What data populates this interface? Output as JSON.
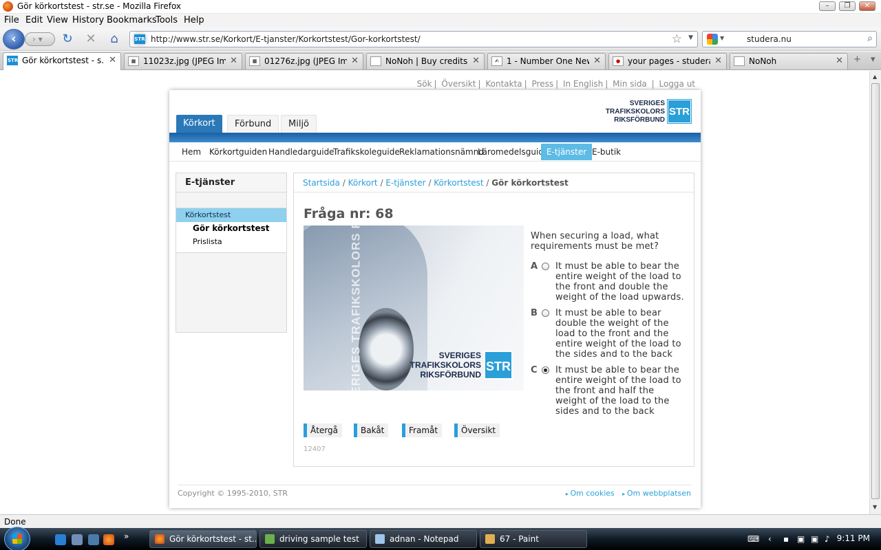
{
  "window": {
    "title": "Gör körkortstest - str.se - Mozilla Firefox"
  },
  "menu": [
    "File",
    "Edit",
    "View",
    "History",
    "Bookmarks",
    "Tools",
    "Help"
  ],
  "nav": {
    "url": "http://www.str.se/Korkort/E-tjanster/Korkortstest/Gor-korkortstest/",
    "search_value": "studera.nu"
  },
  "tabs": [
    {
      "label": "Gör körkortstest - s...",
      "active": true
    },
    {
      "label": "11023z.jpg (JPEG Ima..."
    },
    {
      "label": "01276z.jpg (JPEG Ima..."
    },
    {
      "label": "NoNoh | Buy credits ..."
    },
    {
      "label": "1 - Number One New..."
    },
    {
      "label": "your pages - studera...."
    },
    {
      "label": "NoNoh"
    }
  ],
  "site": {
    "top_links": [
      "Sök",
      "Översikt",
      "Kontakta",
      "Press",
      "In English",
      "Min sida",
      "Logga ut"
    ],
    "logo": {
      "line1": "SVERIGES",
      "line2": "TRAFIKSKOLORS",
      "line3": "RIKSFÖRBUND",
      "mark": "STR"
    },
    "main_tabs": [
      "Körkort",
      "Förbund",
      "Miljö"
    ],
    "sub_nav": [
      "Hem",
      "Körkortguiden",
      "Handledarguide",
      "Trafikskoleguide",
      "Reklamationsnämnd",
      "Läromedelsguide",
      "E-tjänster",
      "E-butik"
    ],
    "sidebar": {
      "heading": "E-tjänster",
      "selected": "Körkortstest",
      "items": [
        "Gör körkortstest",
        "Prislista"
      ]
    },
    "breadcrumb": {
      "links": [
        "Startsida",
        "Körkort",
        "E-tjänster",
        "Körkortstest"
      ],
      "current": "Gör körkortstest"
    },
    "quiz": {
      "title": "Fråga nr: 68",
      "photo_watermark": "SVERIGES TRAFIKSKOLORS RI",
      "question": "When securing a load, what requirements must be met?",
      "options": [
        {
          "letter": "A",
          "text": "It must be able to bear the entire weight of the load to the front and double the weight of the load upwards.",
          "selected": false
        },
        {
          "letter": "B",
          "text": "It must be able to bear double the weight of the load to the front and the entire weight of the load to the sides and to the back",
          "selected": false
        },
        {
          "letter": "C",
          "text": "It must be able to bear the entire weight of the load to the front and half the weight of the load to the sides and to the back",
          "selected": true
        }
      ],
      "buttons": [
        "Återgå",
        "Bakåt",
        "Framåt",
        "Översikt"
      ],
      "code": "12407"
    },
    "footer": {
      "copyright": "Copyright © 1995-2010, STR",
      "links": [
        "Om cookies",
        "Om webbplatsen"
      ]
    }
  },
  "status": "Done",
  "taskbar": {
    "tasks": [
      "Gör körkortstest - st...",
      "driving sample test",
      "adnan - Notepad",
      "67 - Paint"
    ],
    "clock": "9:11 PM"
  },
  "colors": {
    "accent": "#2a9fd8",
    "brand_dark": "#2a78b8",
    "link": "#2a9fd8"
  }
}
